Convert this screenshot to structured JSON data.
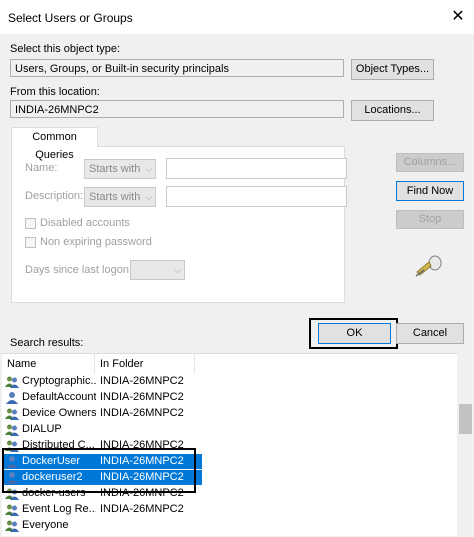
{
  "window": {
    "title": "Select Users or Groups",
    "close_glyph": "✕"
  },
  "object_type": {
    "label": "Select this object type:",
    "value": "Users, Groups, or Built-in security principals",
    "button": "Object Types..."
  },
  "location": {
    "label": "From this location:",
    "value": "INDIA-26MNPC2",
    "button": "Locations..."
  },
  "queries": {
    "tab": "Common Queries",
    "name_label": "Name:",
    "name_mode": "Starts with",
    "description_label": "Description:",
    "description_mode": "Starts with",
    "disabled_accounts": "Disabled accounts",
    "non_expiring_password": "Non expiring password",
    "days_label": "Days since last logon:"
  },
  "side_buttons": {
    "columns": "Columns...",
    "find_now": "Find Now",
    "stop": "Stop"
  },
  "dialog_buttons": {
    "ok": "OK",
    "cancel": "Cancel"
  },
  "results": {
    "label": "Search results:",
    "columns": [
      "Name",
      "In Folder"
    ],
    "rows": [
      {
        "name": "Cryptographic...",
        "folder": "INDIA-26MNPC2",
        "icon": "group-icon",
        "selected": false
      },
      {
        "name": "DefaultAccount",
        "folder": "INDIA-26MNPC2",
        "icon": "user-icon",
        "selected": false
      },
      {
        "name": "Device Owners",
        "folder": "INDIA-26MNPC2",
        "icon": "group-icon",
        "selected": false
      },
      {
        "name": "DIALUP",
        "folder": "",
        "icon": "group-icon",
        "selected": false
      },
      {
        "name": "Distributed C...",
        "folder": "INDIA-26MNPC2",
        "icon": "group-icon",
        "selected": false
      },
      {
        "name": "DockerUser",
        "folder": "INDIA-26MNPC2",
        "icon": "user-icon",
        "selected": true
      },
      {
        "name": "dockeruser2",
        "folder": "INDIA-26MNPC2",
        "icon": "user-icon",
        "selected": true
      },
      {
        "name": "docker-users",
        "folder": "INDIA-26MNPC2",
        "icon": "group-icon",
        "selected": false
      },
      {
        "name": "Event Log Re...",
        "folder": "INDIA-26MNPC2",
        "icon": "group-icon",
        "selected": false
      },
      {
        "name": "Everyone",
        "folder": "",
        "icon": "group-icon",
        "selected": false
      }
    ]
  },
  "colors": {
    "selection": "#0078d7",
    "dialog_bg": "#f0f0f0"
  }
}
